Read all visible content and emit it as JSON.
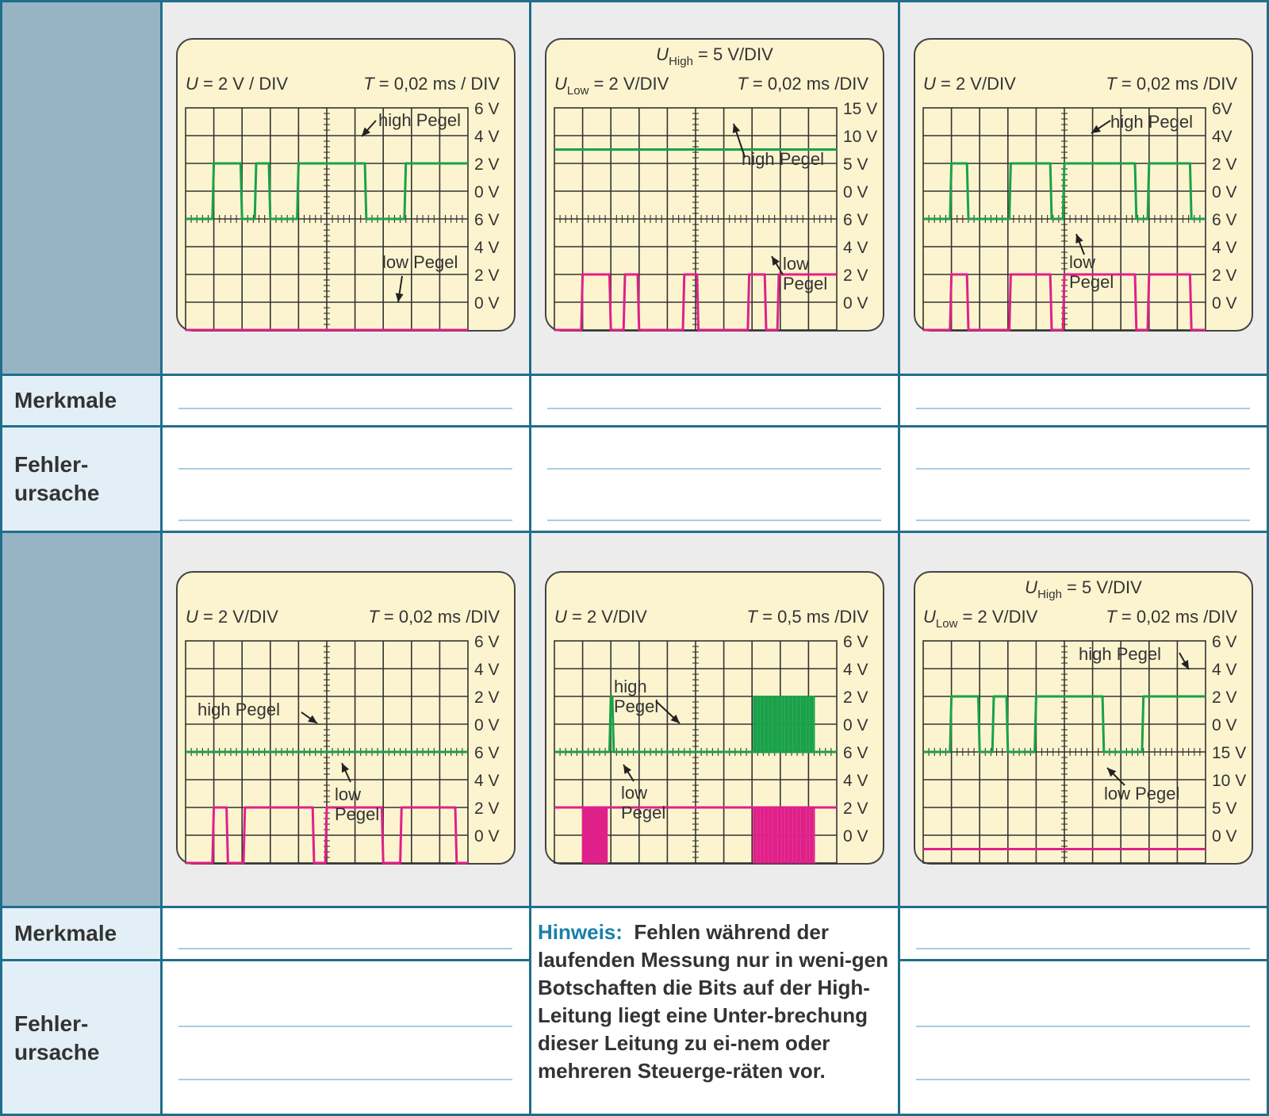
{
  "table": {
    "row_labels": {
      "features": "Merkmale",
      "cause": "Fehler-\nursache"
    },
    "hint": {
      "label": "Hinweis:",
      "text": "Fehlen während der laufenden Messung nur in weni-gen Botschaften die Bits auf der High-Leitung liegt eine Unter-brechung dieser Leitung zu ei-nem oder mehreren Steuerge-räten vor."
    }
  },
  "colors": {
    "high_signal": "#1aa14a",
    "low_signal": "#e0208a",
    "screen_bg": "#fcf4cf",
    "grid": "#333333",
    "frame_border": "#1f6f8b",
    "label_cell": "#e3eff6",
    "image_label_cell": "#97b4c4",
    "image_cell_bg": "#ececec"
  },
  "scopes": [
    {
      "u_header": {
        "symbol": "U",
        "sub": "",
        "text": " = 2 V / DIV"
      },
      "u_header_top": null,
      "t_header": {
        "symbol": "T",
        "text": " = 0,02 ms / DIV"
      },
      "upper_ticks": [
        "6 V",
        "4 V",
        "2 V",
        "0 V"
      ],
      "lower_ticks": [
        "6 V",
        "4 V",
        "2 V",
        "0 V"
      ],
      "annotations": [
        {
          "text": "high Pegel",
          "lines": [
            "high Pegel"
          ]
        },
        {
          "text": "low Pegel",
          "lines": [
            "low Pegel"
          ]
        }
      ]
    },
    {
      "u_header": {
        "symbol": "U",
        "sub": "Low",
        "text": " = 2 V/DIV"
      },
      "u_header_top": {
        "symbol": "U",
        "sub": "High",
        "text": " = 5 V/DIV"
      },
      "t_header": {
        "symbol": "T",
        "text": " = 0,02 ms /DIV"
      },
      "upper_ticks": [
        "15 V",
        "10 V",
        "5 V",
        "0 V"
      ],
      "lower_ticks": [
        "6 V",
        "4 V",
        "2 V",
        "0 V"
      ],
      "annotations": [
        {
          "text": "high Pegel",
          "lines": [
            "high Pegel"
          ]
        },
        {
          "text": "low Pegel",
          "lines": [
            "low",
            "Pegel"
          ]
        }
      ]
    },
    {
      "u_header": {
        "symbol": "U",
        "sub": "",
        "text": " = 2 V/DIV"
      },
      "u_header_top": null,
      "t_header": {
        "symbol": "T",
        "text": " = 0,02 ms /DIV"
      },
      "upper_ticks": [
        "6V",
        "4V",
        "2 V",
        "0 V"
      ],
      "lower_ticks": [
        "6 V",
        "4 V",
        "2 V",
        "0 V"
      ],
      "annotations": [
        {
          "text": "high Pegel",
          "lines": [
            "high Pegel"
          ]
        },
        {
          "text": "low Pegel",
          "lines": [
            "low",
            "Pegel"
          ]
        }
      ]
    },
    {
      "u_header": {
        "symbol": "U",
        "sub": "",
        "text": " = 2 V/DIV"
      },
      "u_header_top": null,
      "t_header": {
        "symbol": "T",
        "text": " = 0,02 ms /DIV"
      },
      "upper_ticks": [
        "6 V",
        "4 V",
        "2 V",
        "0 V"
      ],
      "lower_ticks": [
        "6 V",
        "4 V",
        "2 V",
        "0 V"
      ],
      "annotations": [
        {
          "text": "high Pegel",
          "lines": [
            "high Pegel"
          ]
        },
        {
          "text": "low Pegel",
          "lines": [
            "low",
            "Pegel"
          ]
        }
      ]
    },
    {
      "u_header": {
        "symbol": "U",
        "sub": "",
        "text": " = 2 V/DIV"
      },
      "u_header_top": null,
      "t_header": {
        "symbol": "T",
        "text": " = 0,5 ms /DIV"
      },
      "upper_ticks": [
        "6 V",
        "4 V",
        "2 V",
        "0 V"
      ],
      "lower_ticks": [
        "6 V",
        "4 V",
        "2 V",
        "0 V"
      ],
      "annotations": [
        {
          "text": "high Pegel",
          "lines": [
            "high",
            "Pegel"
          ]
        },
        {
          "text": "low Pegel",
          "lines": [
            "low",
            "Pegel"
          ]
        }
      ]
    },
    {
      "u_header": {
        "symbol": "U",
        "sub": "Low",
        "text": " = 2 V/DIV"
      },
      "u_header_top": {
        "symbol": "U",
        "sub": "High",
        "text": " = 5 V/DIV"
      },
      "t_header": {
        "symbol": "T",
        "text": " = 0,02 ms /DIV"
      },
      "upper_ticks": [
        "6 V",
        "4 V",
        "2 V",
        "0 V"
      ],
      "lower_ticks": [
        "15 V",
        "10 V",
        "5 V",
        "0 V"
      ],
      "annotations": [
        {
          "text": "high Pegel",
          "lines": [
            "high Pegel"
          ]
        },
        {
          "text": "low Pegel",
          "lines": [
            "low Pegel"
          ]
        }
      ]
    }
  ],
  "chart_data": [
    {
      "type": "line",
      "x_unit": "DIV",
      "series": [
        {
          "name": "high Pegel",
          "unit": "V",
          "x": [
            0,
            0.95,
            1.0,
            1.95,
            2.0,
            2.45,
            2.5,
            2.95,
            3.0,
            3.95,
            4.0,
            6.35,
            6.4,
            7.2,
            7.25,
            7.75,
            7.8,
            10.0
          ],
          "y": [
            0,
            0,
            4,
            4,
            0,
            0,
            4,
            4,
            0,
            0,
            4,
            4,
            0,
            0,
            0,
            0,
            4,
            4
          ]
        },
        {
          "name": "low Pegel",
          "unit": "V",
          "x": [
            0,
            10.0
          ],
          "y": [
            0,
            0
          ]
        }
      ]
    },
    {
      "type": "line",
      "x_unit": "DIV",
      "series": [
        {
          "name": "high Pegel",
          "unit": "V",
          "x": [
            0,
            10.0
          ],
          "y": [
            12.5,
            12.5
          ]
        },
        {
          "name": "low Pegel",
          "unit": "V",
          "x": [
            0,
            0.95,
            1.0,
            1.95,
            2.0,
            2.45,
            2.5,
            2.95,
            3.0,
            4.55,
            4.6,
            5.05,
            5.1,
            6.35,
            6.4,
            6.85,
            6.9,
            7.45,
            7.5,
            7.9,
            7.95,
            10.0
          ],
          "y": [
            0,
            0,
            4,
            4,
            0,
            0,
            4,
            4,
            0,
            0,
            4,
            4,
            0,
            0,
            0,
            0,
            4,
            4,
            0,
            0,
            4,
            4
          ]
        }
      ]
    },
    {
      "type": "line",
      "x_unit": "DIV",
      "series": [
        {
          "name": "high Pegel",
          "unit": "V",
          "x": [
            0,
            0.95,
            1.0,
            1.55,
            1.6,
            3.05,
            3.1,
            4.5,
            4.55,
            4.95,
            5.0,
            7.5,
            7.55,
            7.95,
            8.0,
            9.45,
            9.5,
            10.0
          ],
          "y": [
            0,
            0,
            4,
            4,
            0,
            0,
            4,
            4,
            0,
            0,
            4,
            4,
            0,
            0,
            4,
            4,
            0,
            0
          ]
        },
        {
          "name": "low Pegel",
          "unit": "V",
          "x": [
            0,
            0.95,
            1.0,
            1.55,
            1.6,
            3.05,
            3.1,
            4.5,
            4.55,
            4.95,
            5.0,
            7.5,
            7.55,
            7.95,
            8.0,
            9.45,
            9.5,
            10.0
          ],
          "y": [
            0,
            0,
            4,
            4,
            0,
            0,
            4,
            4,
            0,
            0,
            4,
            4,
            0,
            0,
            4,
            4,
            0,
            0
          ]
        }
      ]
    },
    {
      "type": "line",
      "x_unit": "DIV",
      "series": [
        {
          "name": "high Pegel",
          "unit": "V",
          "x": [
            0,
            10.0
          ],
          "y": [
            0,
            0
          ]
        },
        {
          "name": "low Pegel",
          "unit": "V",
          "x": [
            0,
            0.95,
            1.0,
            1.45,
            1.5,
            2.05,
            2.1,
            4.5,
            4.55,
            4.95,
            5.0,
            6.95,
            7.0,
            7.6,
            7.65,
            9.55,
            9.6,
            10.0
          ],
          "y": [
            0,
            0,
            4,
            4,
            0,
            0,
            4,
            4,
            0,
            0,
            4,
            4,
            0,
            0,
            4,
            4,
            0,
            0
          ]
        }
      ]
    },
    {
      "type": "line",
      "x_unit": "DIV",
      "note": "burst regions drawn as dense square waves",
      "series": [
        {
          "name": "high Pegel",
          "unit": "V",
          "x": [
            0,
            1.95,
            2.0,
            2.05,
            2.1,
            10.0
          ],
          "y": [
            0,
            0,
            4,
            4,
            0,
            0
          ],
          "bursts": [
            [
              7.05,
              9.25,
              24
            ]
          ]
        },
        {
          "name": "low Pegel",
          "unit": "V",
          "x": [
            0,
            10.0
          ],
          "y": [
            4,
            4
          ],
          "bursts": [
            [
              1.0,
              1.9,
              14
            ],
            [
              7.05,
              9.25,
              24
            ]
          ]
        }
      ]
    },
    {
      "type": "line",
      "x_unit": "DIV",
      "series": [
        {
          "name": "high Pegel",
          "unit": "V",
          "x": [
            0,
            0.95,
            1.0,
            1.95,
            2.0,
            2.45,
            2.5,
            2.95,
            3.0,
            3.95,
            4.0,
            6.35,
            6.4,
            7.2,
            7.25,
            7.75,
            7.8,
            10.0
          ],
          "y": [
            0,
            0,
            4,
            4,
            0,
            0,
            4,
            4,
            0,
            0,
            4,
            4,
            0,
            0,
            0,
            0,
            4,
            4
          ]
        },
        {
          "name": "low Pegel",
          "unit": "V",
          "x": [
            0,
            10.0
          ],
          "y": [
            2.5,
            2.5
          ]
        }
      ]
    }
  ]
}
